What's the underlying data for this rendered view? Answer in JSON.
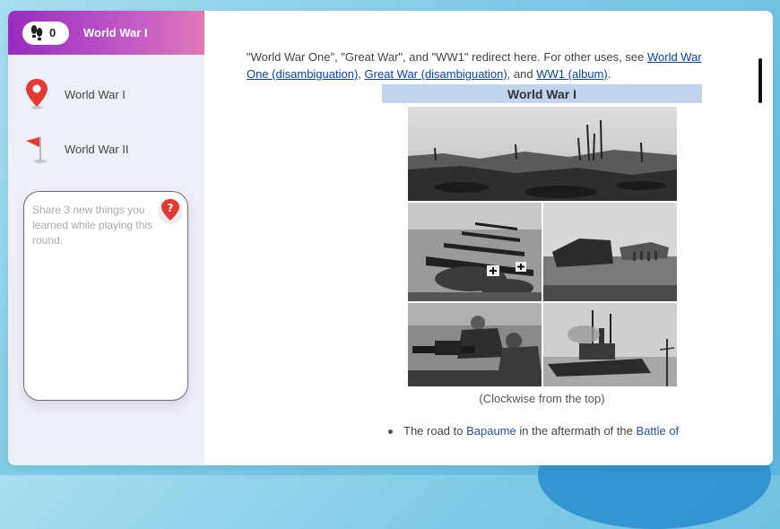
{
  "topbar": {
    "steps_icon": "footsteps-icon",
    "step_count": "0",
    "title": "World War I"
  },
  "nav": [
    {
      "label": "World War I",
      "icon": "map-pin-icon"
    },
    {
      "label": "World War II",
      "icon": "red-flag-icon"
    }
  ],
  "notes": {
    "placeholder": "Share 3 new things you learned while playing this round.",
    "help_icon": "help-icon"
  },
  "article": {
    "intro_text": "\"World War One\", \"Great War\", and \"WW1\" redirect here. For other uses, see ",
    "link1": "World War One (disambiguation)",
    "sep1": ", ",
    "link2": "Great War (disambiguation)",
    "sep2": ", and ",
    "link3": "WW1 (album)",
    "end": ".",
    "infobox_title": "World War I",
    "caption": "(Clockwise from the top)",
    "bullet_prefix": "The road to ",
    "bullet_link1": "Bapaume",
    "bullet_mid": " in the aftermath of the ",
    "bullet_link2": "Battle of"
  },
  "colors": {
    "topbar_start": "#9a2bc0",
    "topbar_end": "#e078b8",
    "link": "#0645ad",
    "infobox_header": "#c0d4ee"
  }
}
